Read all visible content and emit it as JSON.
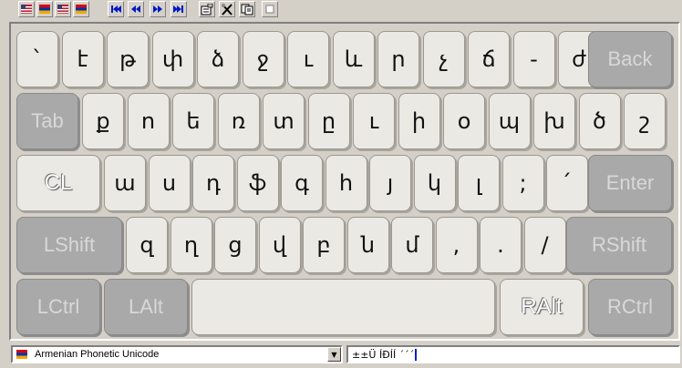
{
  "toolbar": {
    "buttons": [
      {
        "name": "flag-us-icon",
        "glyph": ""
      },
      {
        "name": "flag-armenia-icon",
        "glyph": ""
      },
      {
        "name": "flag-us-2-icon",
        "glyph": ""
      },
      {
        "name": "flag-armenia-2-icon",
        "glyph": ""
      },
      {
        "name": "first-icon",
        "glyph": "⏮"
      },
      {
        "name": "previous-icon",
        "glyph": "◀◀"
      },
      {
        "name": "next-icon",
        "glyph": "▶▶"
      },
      {
        "name": "last-icon",
        "glyph": "⏭"
      },
      {
        "name": "properties-icon",
        "glyph": "▤"
      },
      {
        "name": "tools-icon",
        "glyph": "✕"
      },
      {
        "name": "copy-icon",
        "glyph": "❐"
      },
      {
        "name": "minimize-icon",
        "glyph": "▪"
      }
    ]
  },
  "keyboard": {
    "rows": [
      [
        "`",
        "է",
        "թ",
        "փ",
        "ձ",
        "ջ",
        "ւ",
        "և",
        "ր",
        "չ",
        "ճ",
        "-",
        "ժ"
      ],
      [
        "ք",
        "ո",
        "ե",
        "ռ",
        "տ",
        "ը",
        "ւ",
        "ի",
        "օ",
        "պ",
        "խ",
        "ծ",
        "շ"
      ],
      [
        "ա",
        "ս",
        "դ",
        "ֆ",
        "գ",
        "հ",
        "յ",
        "կ",
        "լ",
        ";",
        "՛"
      ],
      [
        "զ",
        "ղ",
        "ց",
        "վ",
        "բ",
        "ն",
        "մ",
        ",",
        ".",
        "/"
      ]
    ],
    "modifiers": {
      "back": "Back",
      "tab": "Tab",
      "cl": "CL",
      "enter": "Enter",
      "lshift": "LShift",
      "rshift": "RShift",
      "lctrl": "LCtrl",
      "lalt": "LAlt",
      "ralt": "RAlt",
      "rctrl": "RCtrl"
    }
  },
  "status": {
    "layout_selected": "Armenian Phonetic Unicode",
    "text_value": "±±Ü ÍÐÍÍ ´´´"
  },
  "colors": {
    "window_bg": "#d4d0c8",
    "key_face": "#ebe9e4",
    "modifier_key_face": "#a9a9a9",
    "caret": "#001fd0"
  }
}
